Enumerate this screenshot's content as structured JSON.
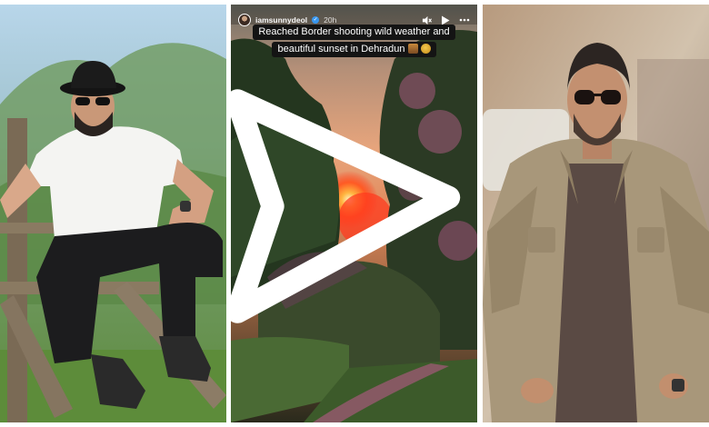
{
  "story": {
    "username": "iamsunnydeol",
    "time": "20h",
    "caption_line1": "Reached Border shooting wild weather and",
    "caption_line2": "beautiful sunset in Dehradun",
    "icons": [
      "mute-icon",
      "play-icon",
      "more-icon",
      "send-icon"
    ]
  },
  "colors": {
    "caption_bg": "#141414",
    "sun": "#ff3b1f",
    "sky": "#e8a57c"
  }
}
